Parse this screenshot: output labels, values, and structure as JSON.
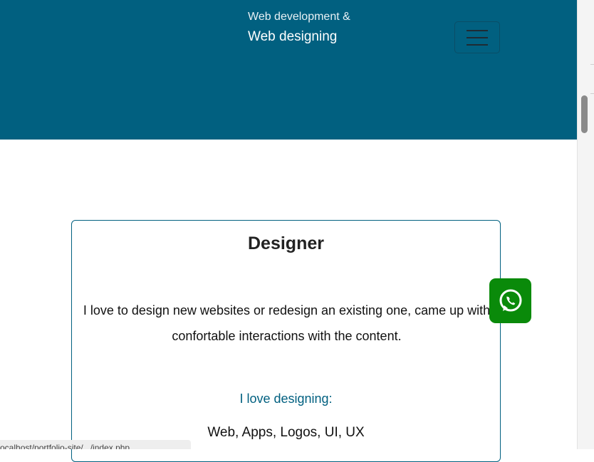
{
  "header": {
    "brand_line1": "Web development &",
    "brand_line2": "Web designing",
    "menu_icon": "hamburger-menu-icon",
    "background_color": "#016080"
  },
  "card": {
    "title": "Designer",
    "description": "I love to design new websites or redesign an existing one, came up with confortable interactions with the content.",
    "love_label": "I love designing:",
    "skills": "Web, Apps, Logos, UI, UX",
    "accent_color": "#016080"
  },
  "whatsapp": {
    "icon": "whatsapp-icon",
    "color": "#0a8a0a"
  },
  "status_bar": {
    "url": "ocalhost/portfolio-site/.../index.php"
  }
}
